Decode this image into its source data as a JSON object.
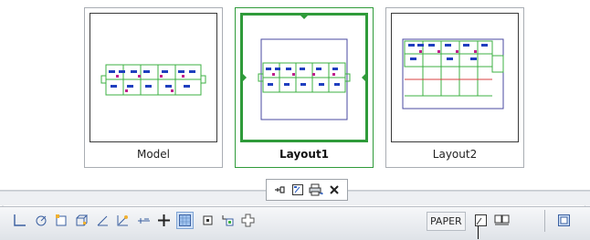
{
  "layout_tabs": [
    {
      "label": "Model",
      "state": "inactive"
    },
    {
      "label": "Layout1",
      "state": "active"
    },
    {
      "label": "Layout2",
      "state": "inactive"
    }
  ],
  "popup_toolbar": {
    "buttons": [
      {
        "name": "pin-icon"
      },
      {
        "name": "page-setup-icon"
      },
      {
        "name": "plot-icon"
      },
      {
        "name": "close-icon"
      }
    ]
  },
  "status_bar": {
    "space_label": "PAPER",
    "drafting_buttons": [
      {
        "name": "snap-icon"
      },
      {
        "name": "polar-tracking-icon"
      },
      {
        "name": "object-snap-icon"
      },
      {
        "name": "3d-object-snap-icon"
      },
      {
        "name": "object-snap-tracking-icon"
      },
      {
        "name": "dynamic-ucs-icon"
      },
      {
        "name": "dynamic-input-icon"
      },
      {
        "name": "lineweight-icon"
      },
      {
        "name": "transparency-icon"
      },
      {
        "name": "quick-properties-icon"
      },
      {
        "name": "selection-cycling-icon"
      },
      {
        "name": "annotation-monitor-icon"
      }
    ]
  },
  "colors": {
    "active_accent": "#2f9b3a",
    "drawing_green": "#3cb043",
    "drawing_blue": "#1f3fbf",
    "drawing_magenta": "#c0208c"
  }
}
